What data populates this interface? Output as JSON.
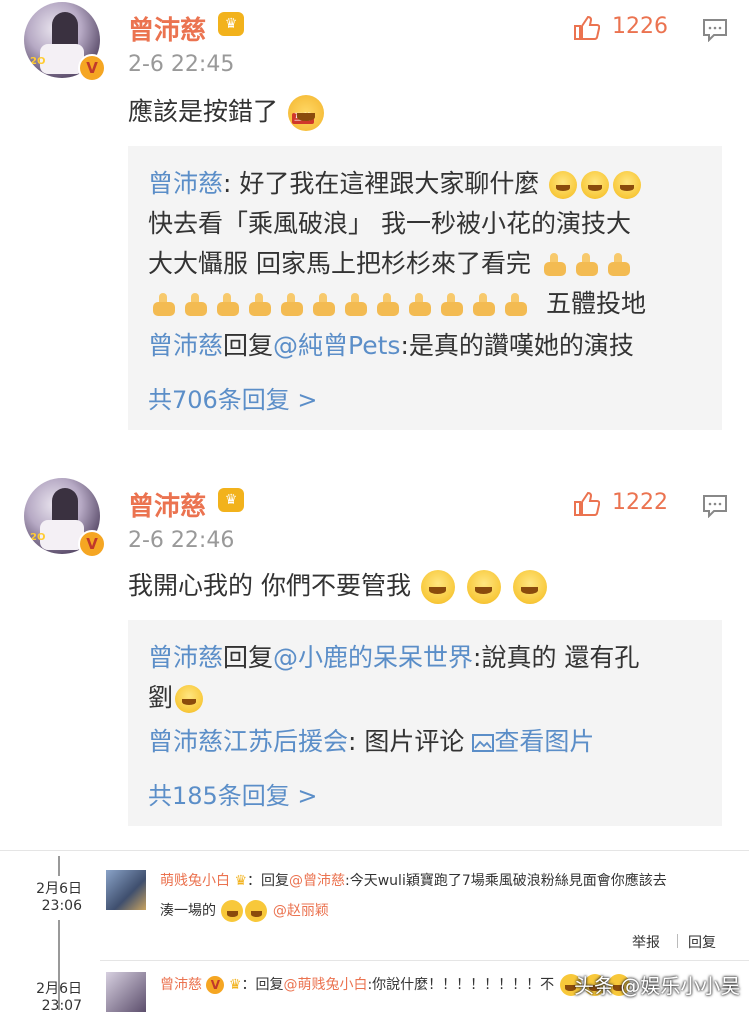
{
  "posts": [
    {
      "username": "曾沛慈",
      "crown_badge": "fan-badge",
      "verified": "V",
      "avatar_label": "2O",
      "time": "2-6 22:45",
      "likes": "1226",
      "text": "應該是按錯了",
      "text_emoji_label": "互粉",
      "quote": {
        "line1_name": "曾沛慈",
        "line1_text": ": 好了我在這裡跟大家聊什麼",
        "line2": "快去看「乘風破浪」 我一秒被小花的演技大",
        "line3": "大大懾服  回家馬上把杉杉來了看完",
        "line4_text": "五體投地",
        "line5_name": "曾沛慈",
        "line5_mid": "回复",
        "line5_at": "@純曾Pets",
        "line5_text": ":是真的讚嘆她的演技",
        "more": "共706条回复 >"
      }
    },
    {
      "username": "曾沛慈",
      "crown_badge": "fan-badge",
      "verified": "V",
      "avatar_label": "2O",
      "time": "2-6 22:46",
      "likes": "1222",
      "text": "我開心我的 你們不要管我",
      "quote": {
        "line1_name": "曾沛慈",
        "line1_mid": "回复",
        "line1_at": "@小鹿的呆呆世界",
        "line1_text": ":說真的  還有孔",
        "line2_text": "劉",
        "line3_name": "曾沛慈江苏后援会",
        "line3_text": ": 图片评论",
        "line3_link": "查看图片",
        "more": "共185条回复 >"
      }
    }
  ],
  "subcomments": [
    {
      "date": "2月6日",
      "time": "23:06",
      "name": "萌贱兔小白",
      "reply_label": "：回复",
      "at": "@曾沛慈",
      "text": ":今天wuli穎寶跑了7場乘風破浪粉絲見面會你應該去",
      "text2": "湊一場的",
      "at2": "@赵丽颖",
      "report": "举报",
      "reply": "回复"
    },
    {
      "date": "2月6日",
      "time": "23:07",
      "name": "曾沛慈",
      "reply_label": "：回复",
      "at": "@萌贱兔小白",
      "text": ":你說什麼！！！！！！！！不"
    }
  ],
  "watermark": "头条 @娱乐小小吴",
  "colors": {
    "accent": "#eb7350",
    "link": "#5b8ec8",
    "quote_bg": "#f4f4f4"
  }
}
